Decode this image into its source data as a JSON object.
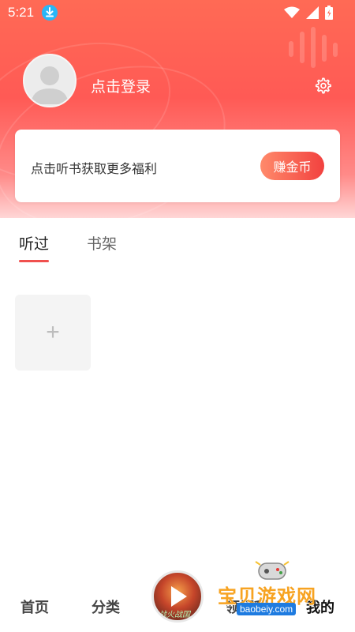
{
  "status_bar": {
    "time": "5:21",
    "icons": [
      "download-icon",
      "wifi-icon",
      "signal-icon",
      "battery-icon"
    ]
  },
  "profile": {
    "login_text": "点击登录",
    "avatar_icon": "default-avatar-icon",
    "settings_icon": "gear-icon"
  },
  "promo": {
    "text": "点击听书获取更多福利",
    "button_label": "赚金币"
  },
  "tabs": [
    {
      "label": "听过",
      "active": true
    },
    {
      "label": "书架",
      "active": false
    }
  ],
  "content": {
    "add_tile_symbol": "+"
  },
  "bottom_nav": {
    "items": [
      {
        "label": "首页"
      },
      {
        "label": "分类"
      },
      {
        "label": "领福利"
      },
      {
        "label": "我的"
      }
    ],
    "player_caption": "战火战国"
  },
  "watermark": {
    "title": "宝贝游戏网",
    "url": "baobeiy.com"
  },
  "colors": {
    "brand_red": "#f2413f",
    "hero_top": "#ff6a55",
    "tab_underline": "#f0504e"
  }
}
